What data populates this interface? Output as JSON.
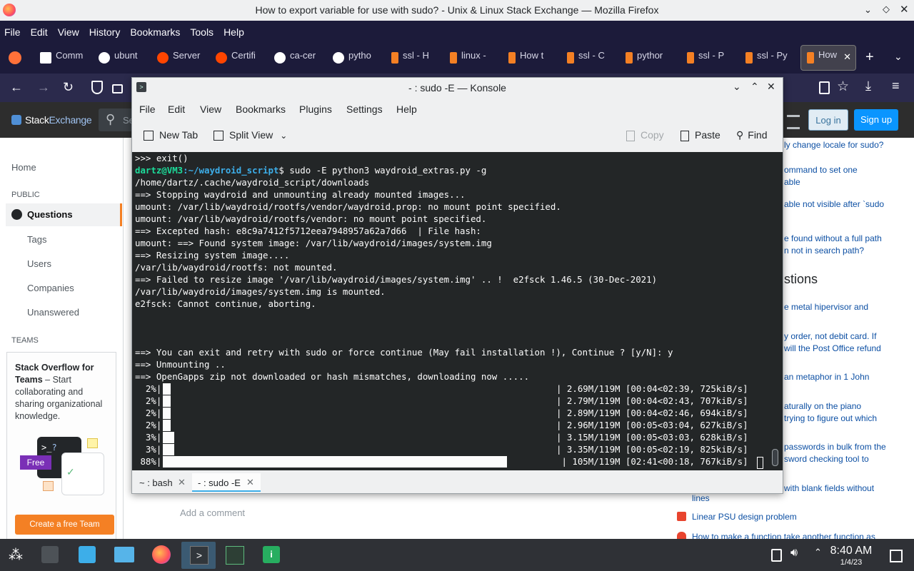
{
  "firefox": {
    "window_title": "How to export variable for use with sudo? - Unix & Linux Stack Exchange — Mozilla Firefox",
    "menu": [
      "File",
      "Edit",
      "View",
      "History",
      "Bookmarks",
      "Tools",
      "Help"
    ],
    "tabs": [
      {
        "label": "Comm",
        "color": "#ffffff"
      },
      {
        "label": "ubunt",
        "color": "#ffffff"
      },
      {
        "label": "Server",
        "color": "#ff4500"
      },
      {
        "label": "Certifi",
        "color": "#ff4500"
      },
      {
        "label": "ca-cer",
        "color": "#ffffff"
      },
      {
        "label": "pytho",
        "color": "#ffffff"
      },
      {
        "label": "ssl - H",
        "color": "#f48024"
      },
      {
        "label": "linux -",
        "color": "#f48024"
      },
      {
        "label": "How t",
        "color": "#f48024"
      },
      {
        "label": "ssl - C",
        "color": "#f48024"
      },
      {
        "label": "pythor",
        "color": "#f48024"
      },
      {
        "label": "ssl - P",
        "color": "#f48024"
      },
      {
        "label": "ssl - Py",
        "color": "#f48024"
      },
      {
        "label": "How",
        "color": "#f48024"
      }
    ]
  },
  "stackexchange": {
    "logo_a": "Stack",
    "logo_b": "Exchange",
    "search_placeholder": "Se",
    "login": "Log in",
    "signup": "Sign up",
    "nav": {
      "home": "Home",
      "public": "PUBLIC",
      "questions": "Questions",
      "tags": "Tags",
      "users": "Users",
      "companies": "Companies",
      "unanswered": "Unanswered",
      "teams": "TEAMS"
    },
    "teams_promo": {
      "title": "Stack Overflow for Teams",
      "dash": " – Start collaborating and sharing organizational knowledge.",
      "badge": "Free",
      "cta": "Create a free Team"
    },
    "add_comment": "Add a comment",
    "related": [
      "ly change locale for sudo?",
      "ommand to set one",
      "able",
      "able not visible after `sudo",
      "e found without a full path",
      "n not in search path?"
    ],
    "hot_heading": "stions",
    "hot": [
      "e metal hipervisor and",
      "y order, not debit card. If",
      " will the Post Office refund",
      "an metaphor in 1 John",
      "aturally on the piano",
      "trying to figure out which",
      "passwords in bulk from the",
      "sword checking tool to",
      "with blank fields without",
      "lines",
      "Linear PSU design problem",
      "How to make a function take another function as"
    ]
  },
  "konsole": {
    "title": "- : sudo -E — Konsole",
    "menu": [
      "File",
      "Edit",
      "View",
      "Bookmarks",
      "Plugins",
      "Settings",
      "Help"
    ],
    "toolbar": {
      "new_tab": "New Tab",
      "split_view": "Split View",
      "copy": "Copy",
      "paste": "Paste",
      "find": "Find"
    },
    "prompt_user": "dartz@VM3",
    "prompt_path": ":~/waydroid_script",
    "prompt_cmd": "$ sudo -E python3 waydroid_extras.py -g",
    "lines": [
      ">>> exit()",
      "",
      "/home/dartz/.cache/waydroid_script/downloads",
      "==> Stopping waydroid and unmounting already mounted images...",
      "umount: /var/lib/waydroid/rootfs/vendor/waydroid.prop: no mount point specified.",
      "umount: /var/lib/waydroid/rootfs/vendor: no mount point specified.",
      "==> Excepted hash: e8c9a7412f5712eea7948957a62a7d66  | File hash:",
      "umount: ==> Found system image: /var/lib/waydroid/images/system.img",
      "==> Resizing system image....",
      "/var/lib/waydroid/rootfs: not mounted.",
      "==> Failed to resize image '/var/lib/waydroid/images/system.img' .. !  e2fsck 1.46.5 (30-Dec-2021)",
      "/var/lib/waydroid/images/system.img is mounted.",
      "e2fsck: Cannot continue, aborting.",
      "",
      "",
      "",
      "==> You can exit and retry with sudo or force continue (May fail installation !), Continue ? [y/N]: y",
      "==> Unmounting ..",
      "==> OpenGapps zip not downloaded or hash mismatches, downloading now ....."
    ],
    "progress": [
      {
        "pct": "  2%|",
        "fill": 0.02,
        "tail": "| 2.69M/119M [00:04<02:39, 725kiB/s]"
      },
      {
        "pct": "  2%|",
        "fill": 0.02,
        "tail": "| 2.79M/119M [00:04<02:43, 707kiB/s]"
      },
      {
        "pct": "  2%|",
        "fill": 0.02,
        "tail": "| 2.89M/119M [00:04<02:46, 694kiB/s]"
      },
      {
        "pct": "  2%|",
        "fill": 0.02,
        "tail": "| 2.96M/119M [00:05<03:04, 627kiB/s]"
      },
      {
        "pct": "  3%|",
        "fill": 0.03,
        "tail": "| 3.15M/119M [00:05<03:03, 628kiB/s]"
      },
      {
        "pct": "  3%|",
        "fill": 0.03,
        "tail": "| 3.35M/119M [00:05<02:19, 825kiB/s]"
      },
      {
        "pct": " 88%|",
        "fill": 0.88,
        "tail": " | 105M/119M [02:41<00:18, 767kiB/s]"
      }
    ],
    "tabs": [
      "~ : bash",
      "- : sudo -E"
    ]
  },
  "taskbar": {
    "time": "8:40 AM",
    "date": "1/4/23"
  }
}
